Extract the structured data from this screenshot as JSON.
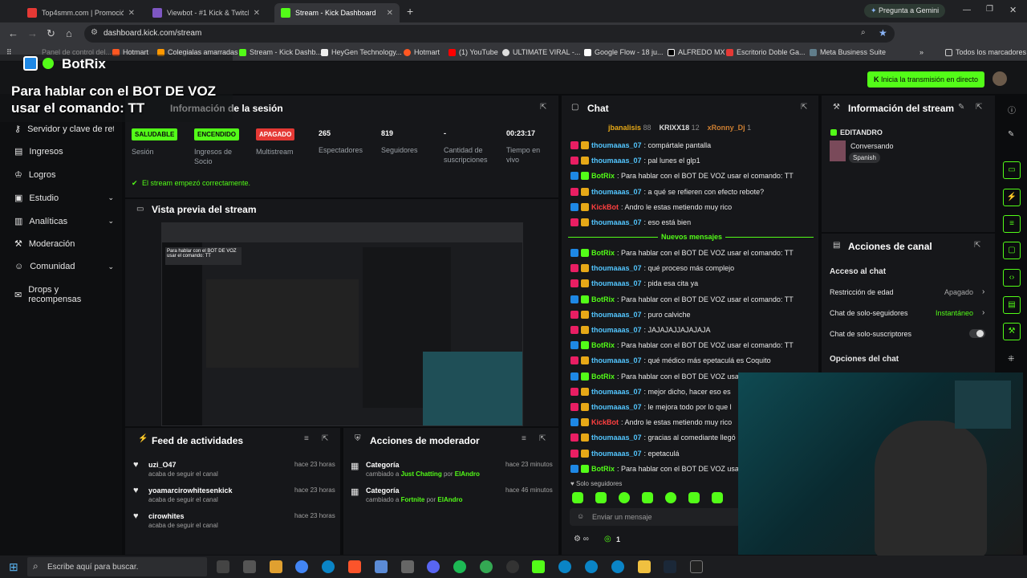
{
  "browser": {
    "tabs": [
      {
        "title": "Top4smm.com | Promoción de",
        "color": "#e53935"
      },
      {
        "title": "Viewbot - #1 Kick & Twitch Vie",
        "color": "#7e57c2"
      },
      {
        "title": "Stream - Kick Dashboard",
        "color": "#53fc18"
      }
    ],
    "new_tab": "+",
    "gemini": "Pregunta a Gemini",
    "url": "dashboard.kick.com/stream",
    "bookmarks": [
      "Hotmart",
      "Colegialas amarradas",
      "Stream - Kick Dashb...",
      "HeyGen Technology...",
      "Hotmart",
      "(1) YouTube",
      "ULTIMATE VIRAL -...",
      "Google Flow - 18 ju...",
      "ALFREDO MX",
      "Escritorio Doble Ga...",
      "Meta Business Suite"
    ],
    "bookmarks_all": "Todos los marcadores",
    "hidden_bm": "Panel de control del..."
  },
  "overlay": {
    "brand": "BotRix",
    "message": "Para hablar con el BOT DE VOZ usar el comando: TT"
  },
  "header": {
    "go_live": "Inicia la transmisión en directo"
  },
  "sidebar": {
    "items": [
      {
        "label": "Servidor y clave de retran",
        "chev": ""
      },
      {
        "label": "Ingresos",
        "chev": ""
      },
      {
        "label": "Logros",
        "chev": ""
      },
      {
        "label": "Estudio",
        "chev": "⌄"
      },
      {
        "label": "Analíticas",
        "chev": "⌄"
      },
      {
        "label": "Moderación",
        "chev": ""
      },
      {
        "label": "Comunidad",
        "chev": "⌄"
      },
      {
        "label": "Drops y recompensas",
        "chev": ""
      }
    ]
  },
  "session": {
    "title": "Información de la sesión",
    "stats": [
      {
        "badge": "SALUDABLE",
        "badge_color": "#53fc18",
        "label": "Sesión"
      },
      {
        "badge": "ENCENDIDO",
        "badge_color": "#53fc18",
        "label": "Ingresos de Socio"
      },
      {
        "badge": "APAGADO",
        "badge_color": "#e53935",
        "label": "Multistream"
      },
      {
        "value": "265",
        "label": "Espectadores"
      },
      {
        "value": "819",
        "label": "Seguidores"
      },
      {
        "value": "-",
        "label": "Cantidad de suscripciones"
      },
      {
        "value": "00:23:17",
        "label": "Tiempo en vivo"
      }
    ],
    "notice": "El stream empezó correctamente."
  },
  "preview": {
    "title": "Vista previa del stream"
  },
  "feed": {
    "title": "Feed de actividades",
    "items": [
      {
        "name": "uzi_O47",
        "sub": "acaba de seguir el canal",
        "time": "hace 23 horas"
      },
      {
        "name": "yoamarcirowhitesenkick",
        "sub": "acaba de seguir el canal",
        "time": "hace 23 horas"
      },
      {
        "name": "cirowhites",
        "sub": "acaba de seguir el canal",
        "time": "hace 23 horas"
      }
    ]
  },
  "modactions": {
    "title": "Acciones de moderador",
    "items": [
      {
        "name": "Categoría",
        "pre": "cambiado a",
        "cat": "Just Chatting",
        "by": "por",
        "user": "ElAndro",
        "time": "hace 23 minutos"
      },
      {
        "name": "Categoría",
        "pre": "cambiado a",
        "cat": "Fortnite",
        "by": "por",
        "user": "ElAndro",
        "time": "hace 46 minutos"
      }
    ]
  },
  "chat": {
    "title": "Chat",
    "top": [
      {
        "name": "jbanalisis",
        "n": "88"
      },
      {
        "name": "KRIXX18",
        "n": "12"
      },
      {
        "name": "xRonny_Dj",
        "n": "1"
      }
    ],
    "messages": [
      {
        "user": "thoumaaas_07",
        "cls": "u-t",
        "text": ": compártale pantalla"
      },
      {
        "user": "thoumaaas_07",
        "cls": "u-t",
        "text": ": pal lunes el glp1"
      },
      {
        "user": "BotRix",
        "cls": "u-b",
        "text": ": Para hablar con el BOT DE VOZ usar el comando: TT"
      },
      {
        "user": "thoumaaas_07",
        "cls": "u-t",
        "text": ": a qué se refieren con efecto rebote?"
      },
      {
        "user": "KickBot",
        "cls": "u-k",
        "text": ": Andro le estas metiendo muy rico"
      },
      {
        "user": "thoumaaas_07",
        "cls": "u-t",
        "text": ": eso está bien"
      }
    ],
    "new_divider": "Nuevos mensajes",
    "messages2": [
      {
        "user": "BotRix",
        "cls": "u-b",
        "text": ": Para hablar con el BOT DE VOZ usar el comando: TT"
      },
      {
        "user": "thoumaaas_07",
        "cls": "u-t",
        "text": ": qué proceso más complejo"
      },
      {
        "user": "thoumaaas_07",
        "cls": "u-t",
        "text": ": pida esa cita ya"
      },
      {
        "user": "BotRix",
        "cls": "u-b",
        "text": ": Para hablar con el BOT DE VOZ usar el comando: TT"
      },
      {
        "user": "thoumaaas_07",
        "cls": "u-t",
        "text": ": puro calviche"
      },
      {
        "user": "thoumaaas_07",
        "cls": "u-t",
        "text": ": JAJAJAJJAJAJAJA"
      },
      {
        "user": "BotRix",
        "cls": "u-b",
        "text": ": Para hablar con el BOT DE VOZ usar el comando: TT"
      },
      {
        "user": "thoumaaas_07",
        "cls": "u-t",
        "text": ": qué médico más epetaculá es Coquito"
      },
      {
        "user": "BotRix",
        "cls": "u-b",
        "text": ": Para hablar con el BOT DE VOZ usar el comando: TT"
      },
      {
        "user": "thoumaaas_07",
        "cls": "u-t",
        "text": ": mejor dicho, hacer eso es"
      },
      {
        "user": "thoumaaas_07",
        "cls": "u-t",
        "text": ": le mejora todo por lo que l"
      },
      {
        "user": "KickBot",
        "cls": "u-k",
        "text": ": Andro le estas metiendo muy rico"
      },
      {
        "user": "thoumaaas_07",
        "cls": "u-t",
        "text": ": gracias al comediante llegó"
      },
      {
        "user": "thoumaaas_07",
        "cls": "u-t",
        "text": ": epetaculá"
      },
      {
        "user": "BotRix",
        "cls": "u-b",
        "text": ": Para hablar con el BOT DE VOZ usar el comando: TT"
      }
    ],
    "followers_only": "Solo seguidores",
    "input_placeholder": "Enviar un mensaje",
    "count": "1",
    "infinity": "∞"
  },
  "streaminfo": {
    "title": "Información del stream",
    "name": "EDITANDRO",
    "category": "Conversando",
    "tag": "Spanish"
  },
  "channel": {
    "title": "Acciones de canal",
    "section": "Acceso al chat",
    "rows": [
      {
        "label": "Restricción de edad",
        "value": "Apagado"
      },
      {
        "label": "Chat de solo-seguidores",
        "value": "Instantáneo"
      },
      {
        "label": "Chat de solo-suscriptores",
        "value": ""
      }
    ],
    "section2": "Opciones del chat"
  },
  "taskbar": {
    "search": "Escribe aquí para buscar."
  },
  "colors": {
    "accent": "#53fc18",
    "bg": "#0b0c0e",
    "card": "#16171a"
  }
}
